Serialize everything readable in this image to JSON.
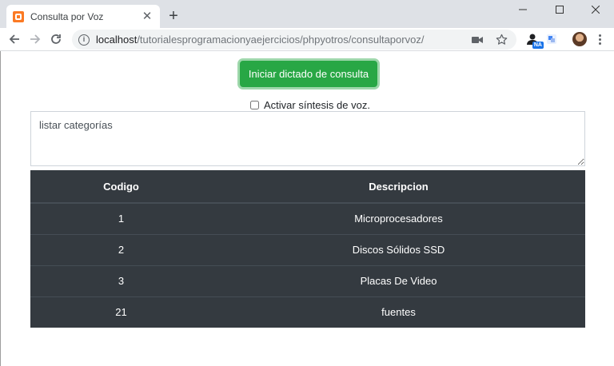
{
  "browser": {
    "tab": {
      "title": "Consulta por Voz"
    },
    "new_tab_label": "+",
    "address_bar": {
      "host": "localhost",
      "path": "/tutorialesprogramacionyaejercicios/phpyotros/consultaporvoz/"
    },
    "extension_badge": "NA"
  },
  "page": {
    "dictate_button_label": "Iniciar dictado de consulta",
    "tts_label": "Activar síntesis de voz.",
    "query_text": "listar categorías",
    "table": {
      "headers": [
        "Codigo",
        "Descripcion"
      ],
      "rows": [
        {
          "codigo": "1",
          "descripcion": "Microprocesadores"
        },
        {
          "codigo": "2",
          "descripcion": "Discos Sólidos SSD"
        },
        {
          "codigo": "3",
          "descripcion": "Placas De Video"
        },
        {
          "codigo": "21",
          "descripcion": "fuentes"
        }
      ]
    }
  },
  "colors": {
    "button_success": "#28a745",
    "table_dark": "#343a40",
    "tab_bar": "#dee1e6"
  }
}
